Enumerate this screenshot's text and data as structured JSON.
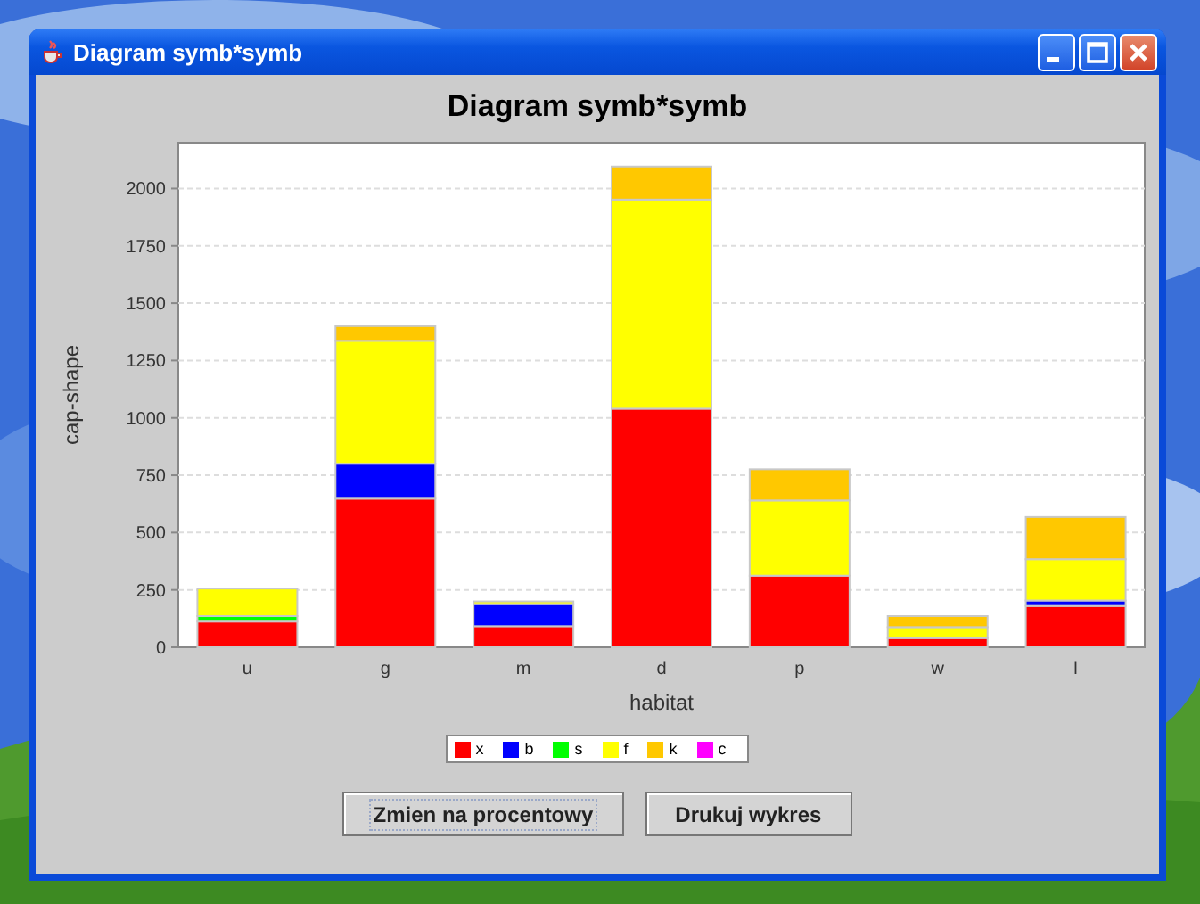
{
  "window": {
    "title": "Diagram symb*symb"
  },
  "chart": {
    "title": "Diagram symb*symb",
    "chart_data": {
      "type": "bar",
      "stacked": true,
      "grid": true,
      "xlabel": "habitat",
      "ylabel": "cap-shape",
      "categories": [
        "u",
        "g",
        "m",
        "d",
        "p",
        "w",
        "l"
      ],
      "ylim": [
        0,
        2200
      ],
      "yticks": [
        0,
        250,
        500,
        750,
        1000,
        1250,
        1500,
        1750,
        2000
      ],
      "series": [
        {
          "name": "x",
          "color": "#ff0000",
          "values": [
            112,
            648,
            92,
            1040,
            312,
            40,
            180
          ]
        },
        {
          "name": "b",
          "color": "#0000ff",
          "values": [
            0,
            152,
            96,
            0,
            0,
            0,
            24
          ]
        },
        {
          "name": "s",
          "color": "#00ff00",
          "values": [
            24,
            0,
            0,
            0,
            0,
            0,
            0
          ]
        },
        {
          "name": "f",
          "color": "#ffff00",
          "values": [
            120,
            536,
            12,
            912,
            328,
            48,
            180
          ]
        },
        {
          "name": "k",
          "color": "#ffc800",
          "values": [
            0,
            64,
            0,
            144,
            136,
            48,
            184
          ]
        },
        {
          "name": "c",
          "color": "#ff00ff",
          "values": [
            0,
            0,
            0,
            0,
            0,
            0,
            0
          ]
        }
      ]
    }
  },
  "buttons": [
    {
      "label": "Zmien na procentowy",
      "focused": true
    },
    {
      "label": "Drukuj wykres",
      "focused": false
    }
  ]
}
